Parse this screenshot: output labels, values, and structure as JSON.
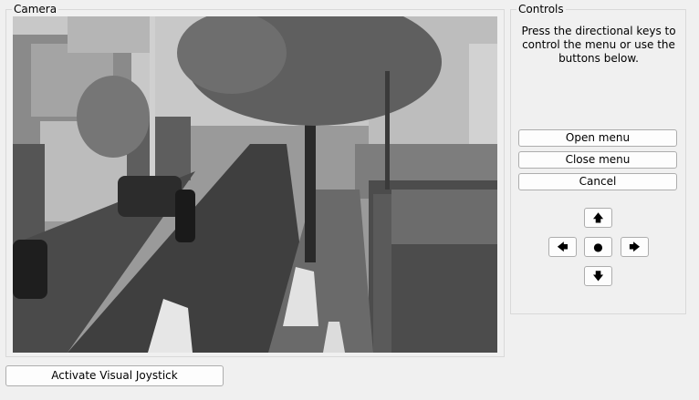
{
  "camera": {
    "title": "Camera",
    "feed_description_icon": "camera-feed"
  },
  "controls": {
    "title": "Controls",
    "instructions": "Press the directional keys to control the menu or use the buttons below.",
    "open_menu_label": "Open menu",
    "close_menu_label": "Close menu",
    "cancel_label": "Cancel",
    "up_glyph": "🡅",
    "left_glyph": "🡄",
    "center_glyph": "●",
    "right_glyph": "🡆",
    "down_glyph": "🡇"
  },
  "footer": {
    "activate_label": "Activate Visual Joystick"
  }
}
